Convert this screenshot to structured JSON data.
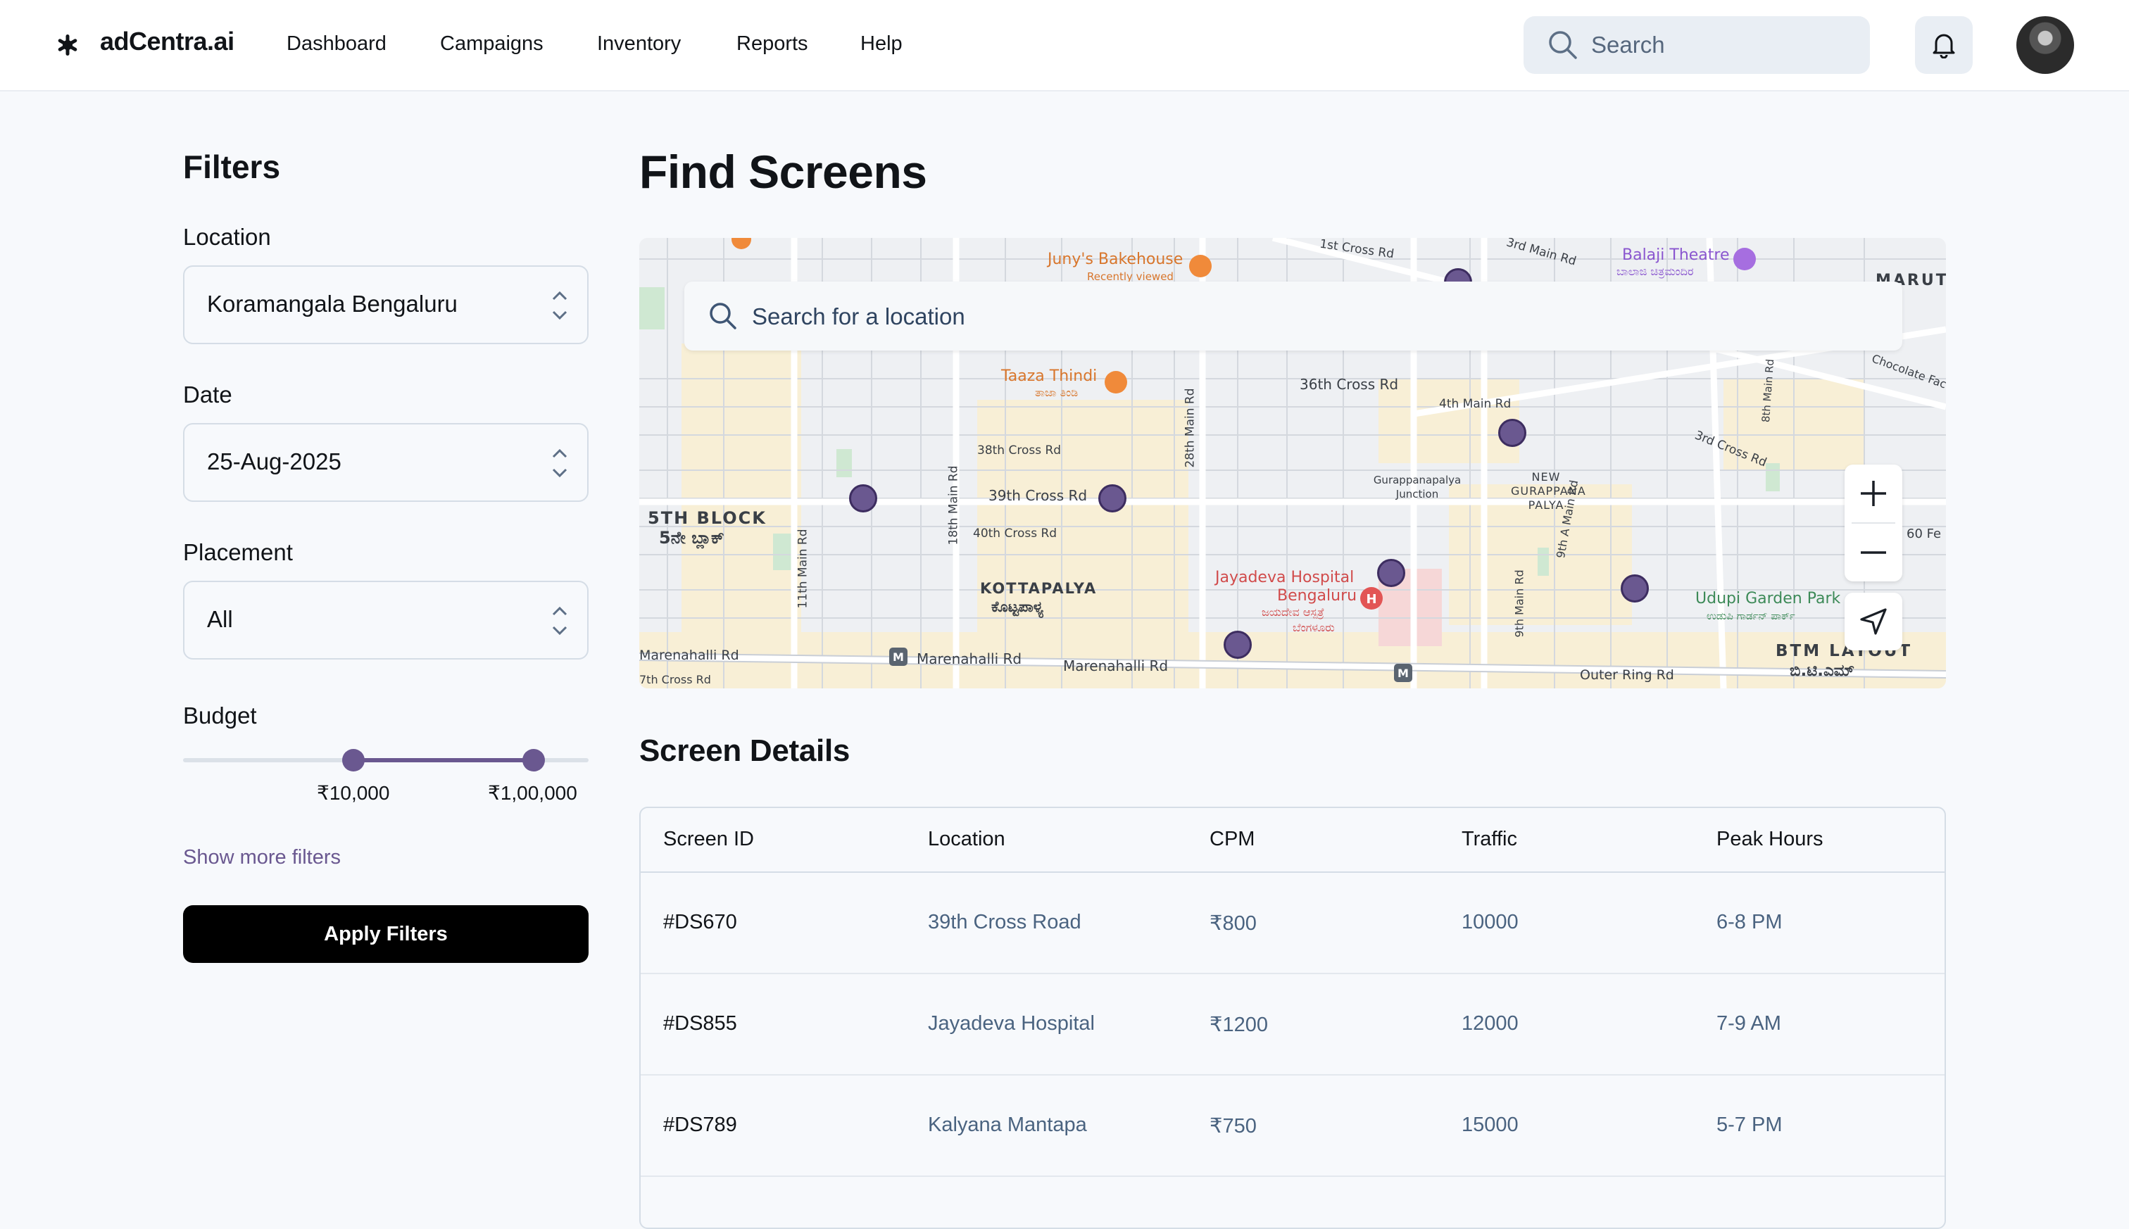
{
  "app": {
    "name": "adCentra.ai"
  },
  "nav": {
    "items": [
      {
        "label": "Dashboard"
      },
      {
        "label": "Campaigns"
      },
      {
        "label": "Inventory"
      },
      {
        "label": "Reports"
      },
      {
        "label": "Help"
      }
    ]
  },
  "header": {
    "search_placeholder": "Search",
    "notification_icon": "bell-icon",
    "avatar_icon": "user-avatar"
  },
  "filters": {
    "title": "Filters",
    "location": {
      "label": "Location",
      "value": "Koramangala Bengaluru"
    },
    "date": {
      "label": "Date",
      "value": "25-Aug-2025"
    },
    "placement": {
      "label": "Placement",
      "value": "All"
    },
    "budget": {
      "label": "Budget",
      "min_label": "₹10,000",
      "max_label": "₹1,00,000"
    },
    "show_more": "Show more filters",
    "apply": "Apply Filters"
  },
  "main": {
    "title": "Find Screens",
    "map": {
      "search_placeholder": "Search for a location",
      "markers_count": 9,
      "labels": {
        "junys": "Juny's Bakehouse",
        "junys_sub": "Recently viewed",
        "balaji": "Balaji Theatre",
        "balaji_kn": "ಬಾಲಾಜಿ ಚಿತ್ರಮಂದಿರ",
        "taaza": "Taaza Thindi",
        "taaza_kn": "ತಾಜಾ ತಿಂಡಿ",
        "r36": "36th Cross Rd",
        "r4main": "4th Main Rd",
        "r38": "38th Cross Rd",
        "r39": "39th Cross Rd",
        "r40": "40th Cross Rd",
        "block5": "5TH BLOCK",
        "block5_kn": "5ನೇ ಬ್ಲಾಕ್",
        "kottapalya": "KOTTAPALYA",
        "kottapalya_kn": "ಕೊಟ್ಟಪಾಳ್ಯ",
        "jayadeva": "Jayadeva Hospital",
        "jayadeva2": "Bengaluru",
        "jayadeva_kn1": "ಜಯದೇವ ಆಸ್ಪತ್ರೆ",
        "jayadeva_kn2": "ಬೆಂಗಳೂರು",
        "marenahalli": "Marenahalli Rd",
        "outer_ring": "Outer Ring Rd",
        "btm": "BTM LAYOUT",
        "btm_kn": "ಬಿ.ಟಿ.ಎಮ್",
        "udupi": "Udupi Garden Park",
        "udupi_kn": "ಉಡುಪಿ ಗಾರ್ಡನ್ ಪಾರ್ಕ್",
        "new_gp": "NEW GURAPPANA PALYA",
        "gp_junction": "Gurappanapalya Junction",
        "r3rdcross": "3rd Cross Rd",
        "r3rdmain": "3rd Main Rd",
        "r1cross": "1st Cross Rd",
        "r18main": "18th Main Rd",
        "r28main": "28th Main Rd",
        "r11main": "11th Main Rd",
        "r9main": "9th Main Rd",
        "r9amain": "9th A Main Rd",
        "r8main": "8th Main Rd",
        "r7cross": "7th Cross Rd",
        "maruti": "MARUT",
        "chocolate": "Chocolate Fac",
        "r60": "60 Fe"
      }
    },
    "screen_details": {
      "title": "Screen Details",
      "columns": [
        "Screen ID",
        "Location",
        "CPM",
        "Traffic",
        "Peak Hours"
      ],
      "rows": [
        {
          "id": "#DS670",
          "location": "39th Cross Road",
          "cpm": "₹800",
          "traffic": "10000",
          "peak": "6-8 PM"
        },
        {
          "id": "#DS855",
          "location": "Jayadeva Hospital",
          "cpm": "₹1200",
          "traffic": "12000",
          "peak": "7-9 AM"
        },
        {
          "id": "#DS789",
          "location": "Kalyana Mantapa",
          "cpm": "₹750",
          "traffic": "15000",
          "peak": "5-7 PM"
        }
      ]
    }
  },
  "colors": {
    "accent": "#6a5890",
    "link": "#4a6380",
    "primary_button": "#000000",
    "background": "#f7f9fc"
  }
}
